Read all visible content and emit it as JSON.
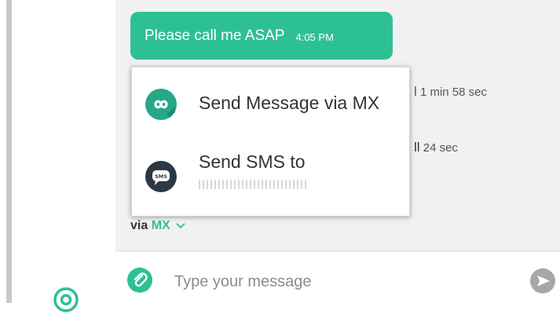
{
  "conversation": {
    "message": {
      "text": "Please call me ASAP",
      "time": "4:05 PM"
    },
    "call_log": [
      {
        "prefix": "l",
        "duration": "1 min 58 sec"
      },
      {
        "prefix": "ll",
        "duration": "24 sec"
      }
    ]
  },
  "send_menu": {
    "items": [
      {
        "label": "Send Message via MX",
        "icon": "infinity-icon"
      },
      {
        "label": "Send SMS to",
        "icon": "sms-icon"
      }
    ]
  },
  "channel_selector": {
    "prefix": "via",
    "value": "MX",
    "icon": "chevron-down-icon"
  },
  "composer": {
    "placeholder": "Type your message"
  },
  "colors": {
    "accent": "#2ec095",
    "sms_icon_bg": "#2d3845",
    "send_button": "#a7a7a7"
  }
}
